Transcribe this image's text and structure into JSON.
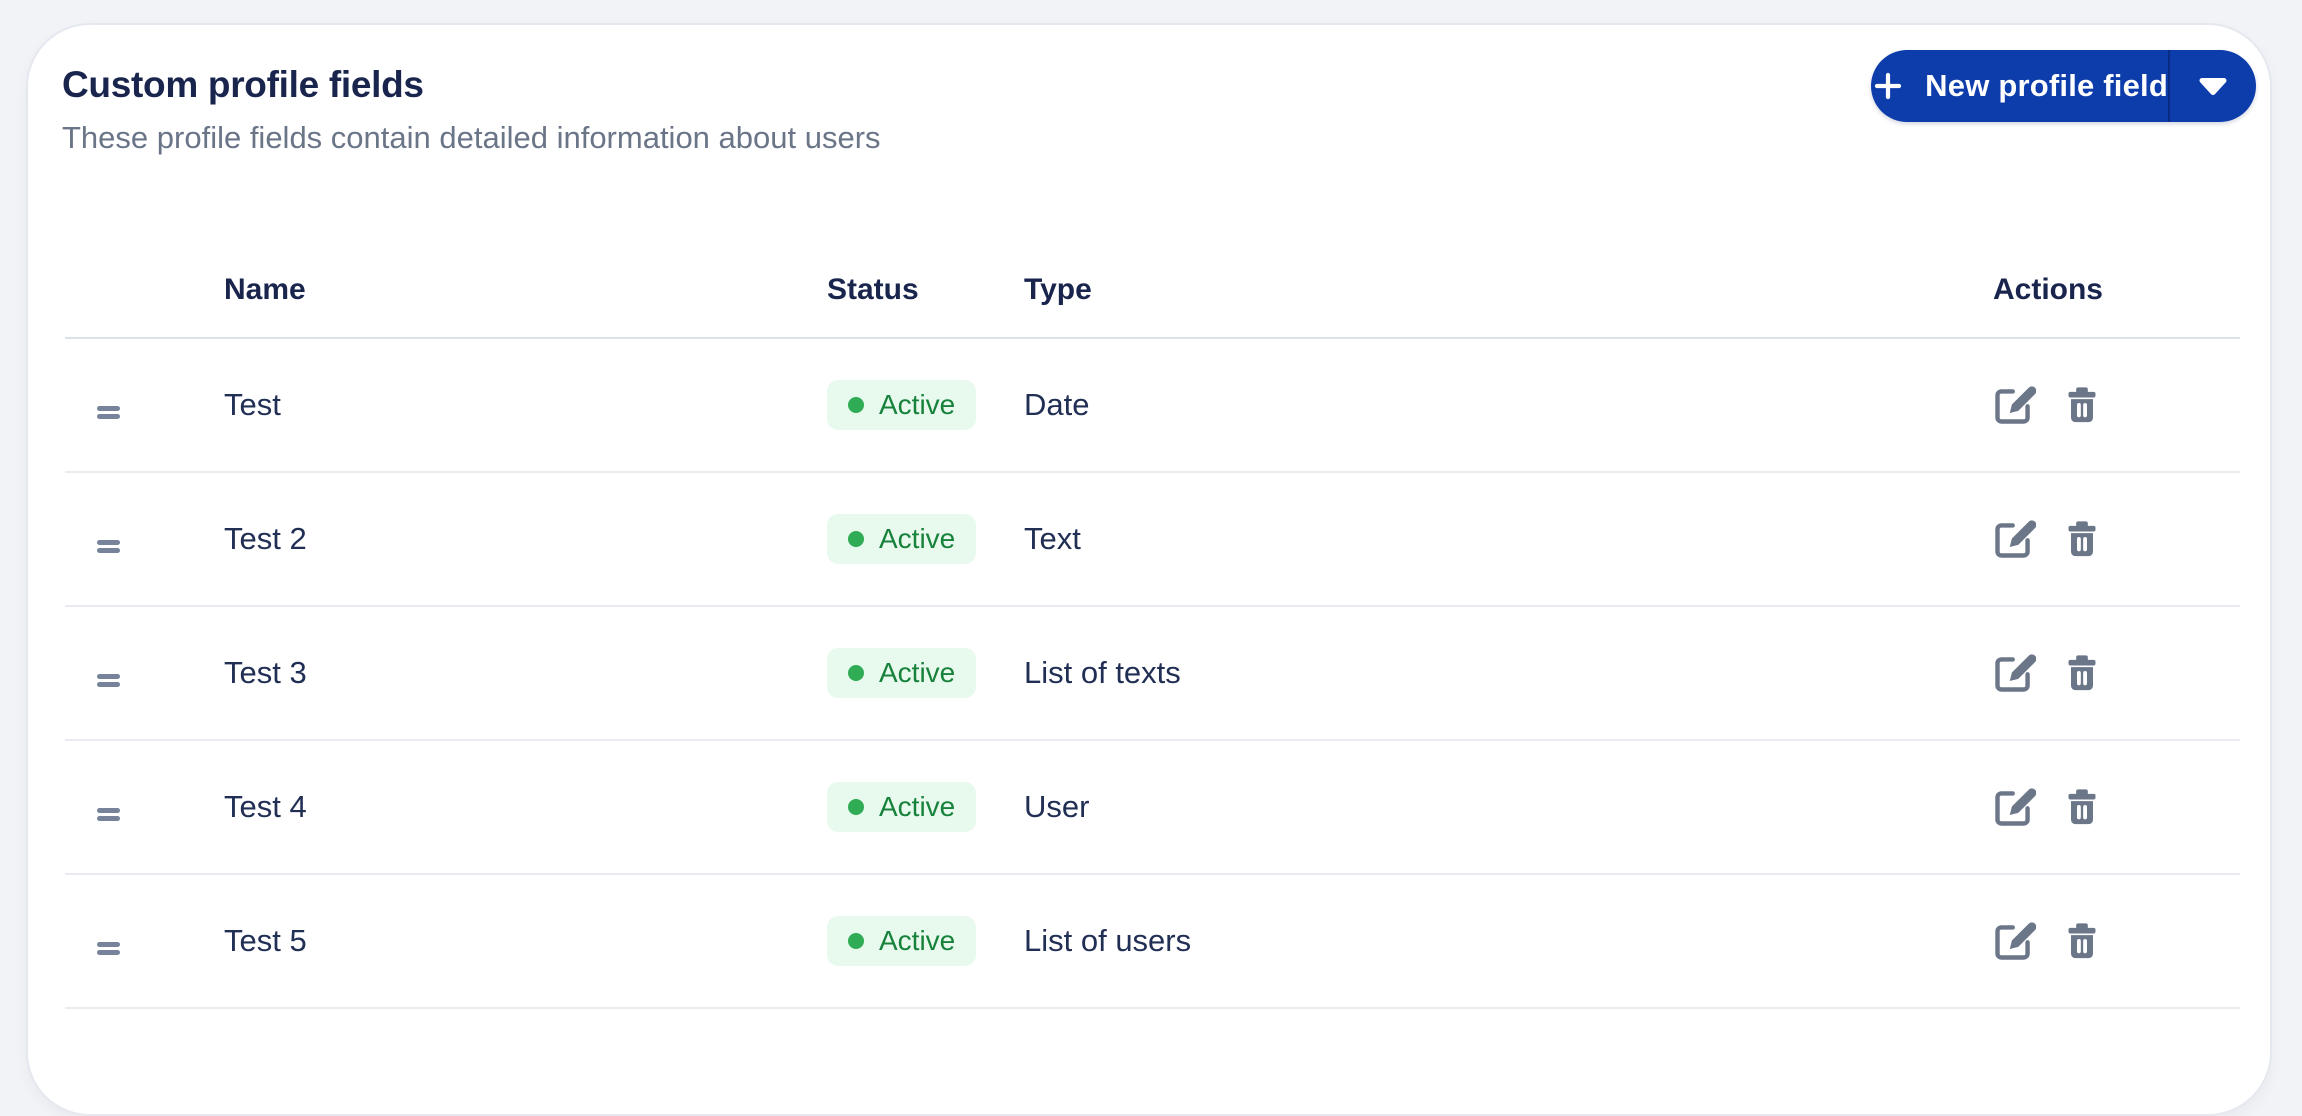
{
  "header": {
    "title": "Custom profile fields",
    "subtitle": "These profile fields contain detailed information about users"
  },
  "toolbar": {
    "new_button_label": "New profile field"
  },
  "table": {
    "columns": {
      "name": "Name",
      "status": "Status",
      "type": "Type",
      "actions": "Actions"
    },
    "rows": [
      {
        "name": "Test",
        "status": "Active",
        "type": "Date"
      },
      {
        "name": "Test 2",
        "status": "Active",
        "type": "Text"
      },
      {
        "name": "Test 3",
        "status": "Active",
        "type": "List of texts"
      },
      {
        "name": "Test 4",
        "status": "Active",
        "type": "User"
      },
      {
        "name": "Test 5",
        "status": "Active",
        "type": "List of users"
      }
    ]
  },
  "icons": {
    "plus": "plus-icon",
    "caret": "caret-down-icon",
    "drag": "drag-handle-icon",
    "edit": "edit-icon",
    "trash": "trash-icon",
    "status_dot": "status-dot-icon"
  },
  "colors": {
    "primary": "#0d3cab",
    "primary_divider": "#0a2c80",
    "badge_bg": "#e8f9ee",
    "badge_text": "#17823b",
    "badge_dot": "#2fac54",
    "title_text": "#19254d",
    "cell_text": "#212f55",
    "muted_text": "#6a7588",
    "icon": "#6b7689",
    "page_bg": "#f1f3f7",
    "card_border": "#e5e8ee",
    "divider": "#e8ebf0"
  }
}
